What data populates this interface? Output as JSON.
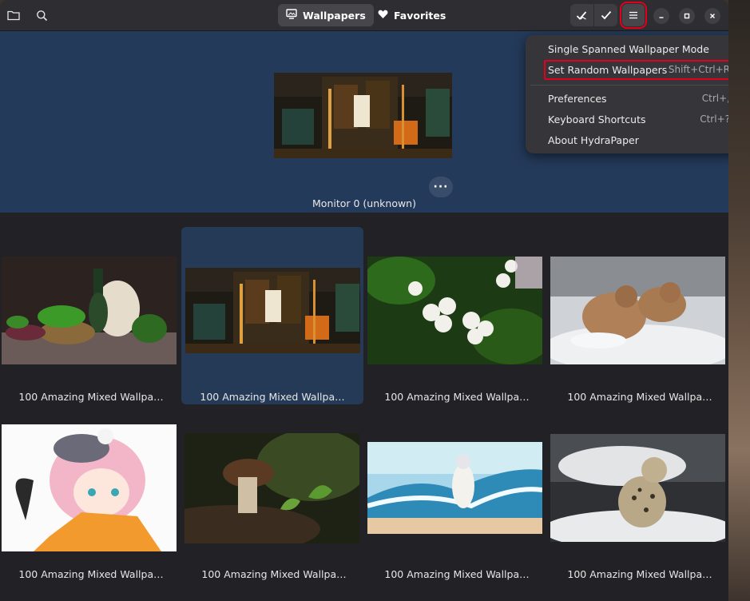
{
  "header": {
    "tabs": [
      {
        "label": "Wallpapers",
        "icon": "monitor-icon",
        "active": true
      },
      {
        "label": "Favorites",
        "icon": "heart-icon",
        "active": false
      }
    ],
    "icons": [
      "folder-icon",
      "search-icon",
      "apply-check-icon",
      "check-icon",
      "hamburger-menu-icon",
      "minimize-icon",
      "maximize-icon",
      "close-icon"
    ]
  },
  "monitor": {
    "label": "Monitor 0 (unknown)",
    "more_button": "···"
  },
  "menu": {
    "items": [
      {
        "label": "Single Spanned Wallpaper Mode",
        "accel": ""
      },
      {
        "label": "Set Random Wallpapers",
        "accel": "Shift+Ctrl+R",
        "highlighted": true
      },
      {
        "label": "Preferences",
        "accel": "Ctrl+,"
      },
      {
        "label": "Keyboard Shortcuts",
        "accel": "Ctrl+?"
      },
      {
        "label": "About HydraPaper",
        "accel": ""
      }
    ]
  },
  "gallery": {
    "items": [
      {
        "label": "100 Amazing Mixed Wallpa…",
        "subject": "vegetables still life"
      },
      {
        "label": "100 Amazing Mixed Wallpa…",
        "subject": "anime tram night",
        "selected": true
      },
      {
        "label": "100 Amazing Mixed Wallpa…",
        "subject": "white flowers"
      },
      {
        "label": "100 Amazing Mixed Wallpa…",
        "subject": "lynx in snow"
      },
      {
        "label": "100 Amazing Mixed Wallpa…",
        "subject": "anime catgirl"
      },
      {
        "label": "100 Amazing Mixed Wallpa…",
        "subject": "mushroom"
      },
      {
        "label": "100 Amazing Mixed Wallpa…",
        "subject": "anime girl beach wave"
      },
      {
        "label": "100 Amazing Mixed Wallpa…",
        "subject": "snow leopard"
      }
    ]
  },
  "colors": {
    "accent_blue": "#243a5a",
    "selected_card": "#253a57",
    "highlight_red": "#e3001b"
  }
}
